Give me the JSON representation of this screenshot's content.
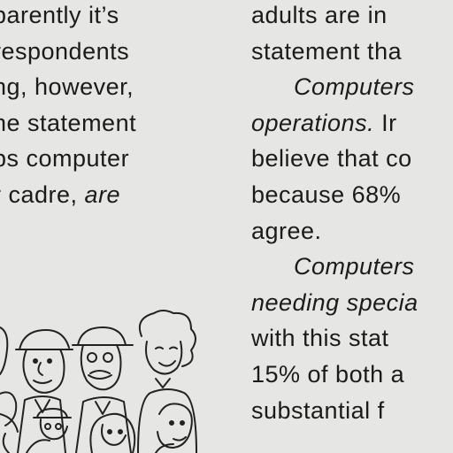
{
  "left_column": [
    {
      "parts": [
        {
          "t": "parently it’s",
          "i": false
        }
      ]
    },
    {
      "parts": [
        {
          "t": "respondents",
          "i": false
        }
      ]
    },
    {
      "parts": [
        {
          "t": "ng, however,",
          "i": false
        }
      ]
    },
    {
      "parts": [
        {
          "t": "he statement",
          "i": false
        }
      ]
    },
    {
      "parts": [
        {
          "t": "ps computer",
          "i": false
        }
      ]
    },
    {
      "parts": [
        {
          "t": "r cadre, ",
          "i": false
        },
        {
          "t": "are",
          "i": true
        }
      ]
    }
  ],
  "right_column": [
    {
      "parts": [
        {
          "t": "adults are in",
          "i": false
        }
      ]
    },
    {
      "parts": [
        {
          "t": "statement tha",
          "i": false
        }
      ]
    },
    {
      "parts": [
        {
          "t": "Computers",
          "i": true
        }
      ]
    },
    {
      "parts": [
        {
          "t": "operations.",
          "i": true
        },
        {
          "t": " Ir",
          "i": false
        }
      ]
    },
    {
      "parts": [
        {
          "t": "believe that co",
          "i": false
        }
      ]
    },
    {
      "parts": [
        {
          "t": "because 68%",
          "i": false
        }
      ]
    },
    {
      "parts": [
        {
          "t": "agree.",
          "i": false
        }
      ]
    },
    {
      "parts": [
        {
          "t": "Computers",
          "i": true
        }
      ]
    },
    {
      "parts": [
        {
          "t": "needing specia",
          "i": true
        }
      ]
    },
    {
      "parts": [
        {
          "t": "with this stat",
          "i": false
        }
      ]
    },
    {
      "parts": [
        {
          "t": "15% of both a",
          "i": false
        }
      ]
    },
    {
      "parts": [
        {
          "t": "substantial f",
          "i": false
        }
      ]
    }
  ],
  "illustration_icon": "crowd-of-cartoon-people-icon"
}
